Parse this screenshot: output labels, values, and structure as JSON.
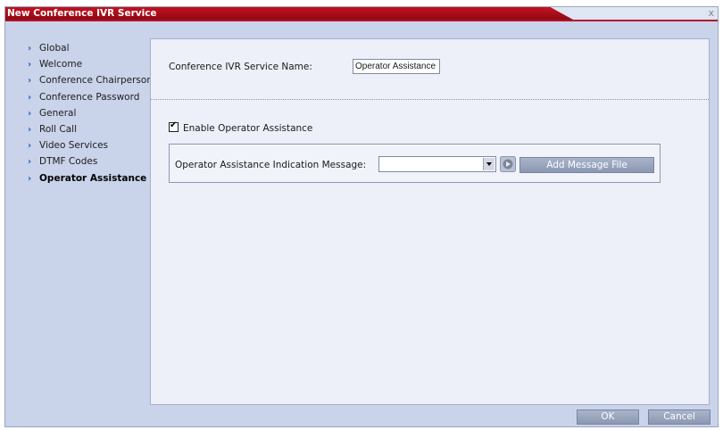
{
  "window": {
    "title": "New Conference IVR Service",
    "close_glyph": "x"
  },
  "sidebar": {
    "items": [
      {
        "label": "Global",
        "active": false
      },
      {
        "label": "Welcome",
        "active": false
      },
      {
        "label": "Conference Chairperson",
        "active": false
      },
      {
        "label": "Conference Password",
        "active": false
      },
      {
        "label": "General",
        "active": false
      },
      {
        "label": "Roll Call",
        "active": false
      },
      {
        "label": "Video Services",
        "active": false
      },
      {
        "label": "DTMF Codes",
        "active": false
      },
      {
        "label": "Operator Assistance",
        "active": true
      }
    ]
  },
  "form": {
    "service_name_label": "Conference IVR Service Name:",
    "service_name_value": "Operator Assistance",
    "enable_label": "Enable Operator Assistance",
    "enable_checked": true,
    "indication_label": "Operator Assistance Indication Message:",
    "indication_value": "",
    "add_file_label": "Add Message File"
  },
  "footer": {
    "ok_label": "OK",
    "cancel_label": "Cancel"
  },
  "icons": {
    "nav_chevron": "chevron-right-icon",
    "play": "speaker-play-icon",
    "dropdown": "chevron-down-icon"
  },
  "colors": {
    "title_bar": "#b4122b",
    "dialog_background": "#c9d3ea",
    "panel_background": "#eef0f9",
    "button": "#9aa5bd",
    "nav_arrow": "#2360b0"
  }
}
